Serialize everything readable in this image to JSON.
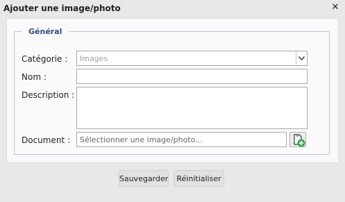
{
  "dialog": {
    "title": "Ajouter une image/photo",
    "close_icon": "close-icon"
  },
  "fieldset": {
    "legend": "Général"
  },
  "form": {
    "category": {
      "label": "Catégorie :",
      "value": "Images"
    },
    "name": {
      "label": "Nom :",
      "value": ""
    },
    "description": {
      "label": "Description :",
      "value": ""
    },
    "document": {
      "label": "Document :",
      "placeholder": "Sélectionner une image/photo...",
      "browse_icon": "add-file-icon"
    }
  },
  "actions": {
    "save_label": "Sauvegarder",
    "reset_label": "Réinitialiser"
  },
  "colors": {
    "legend": "#2b4e8a",
    "fieldset_border": "#b8c3d8",
    "add_icon": "#3bb04a"
  }
}
